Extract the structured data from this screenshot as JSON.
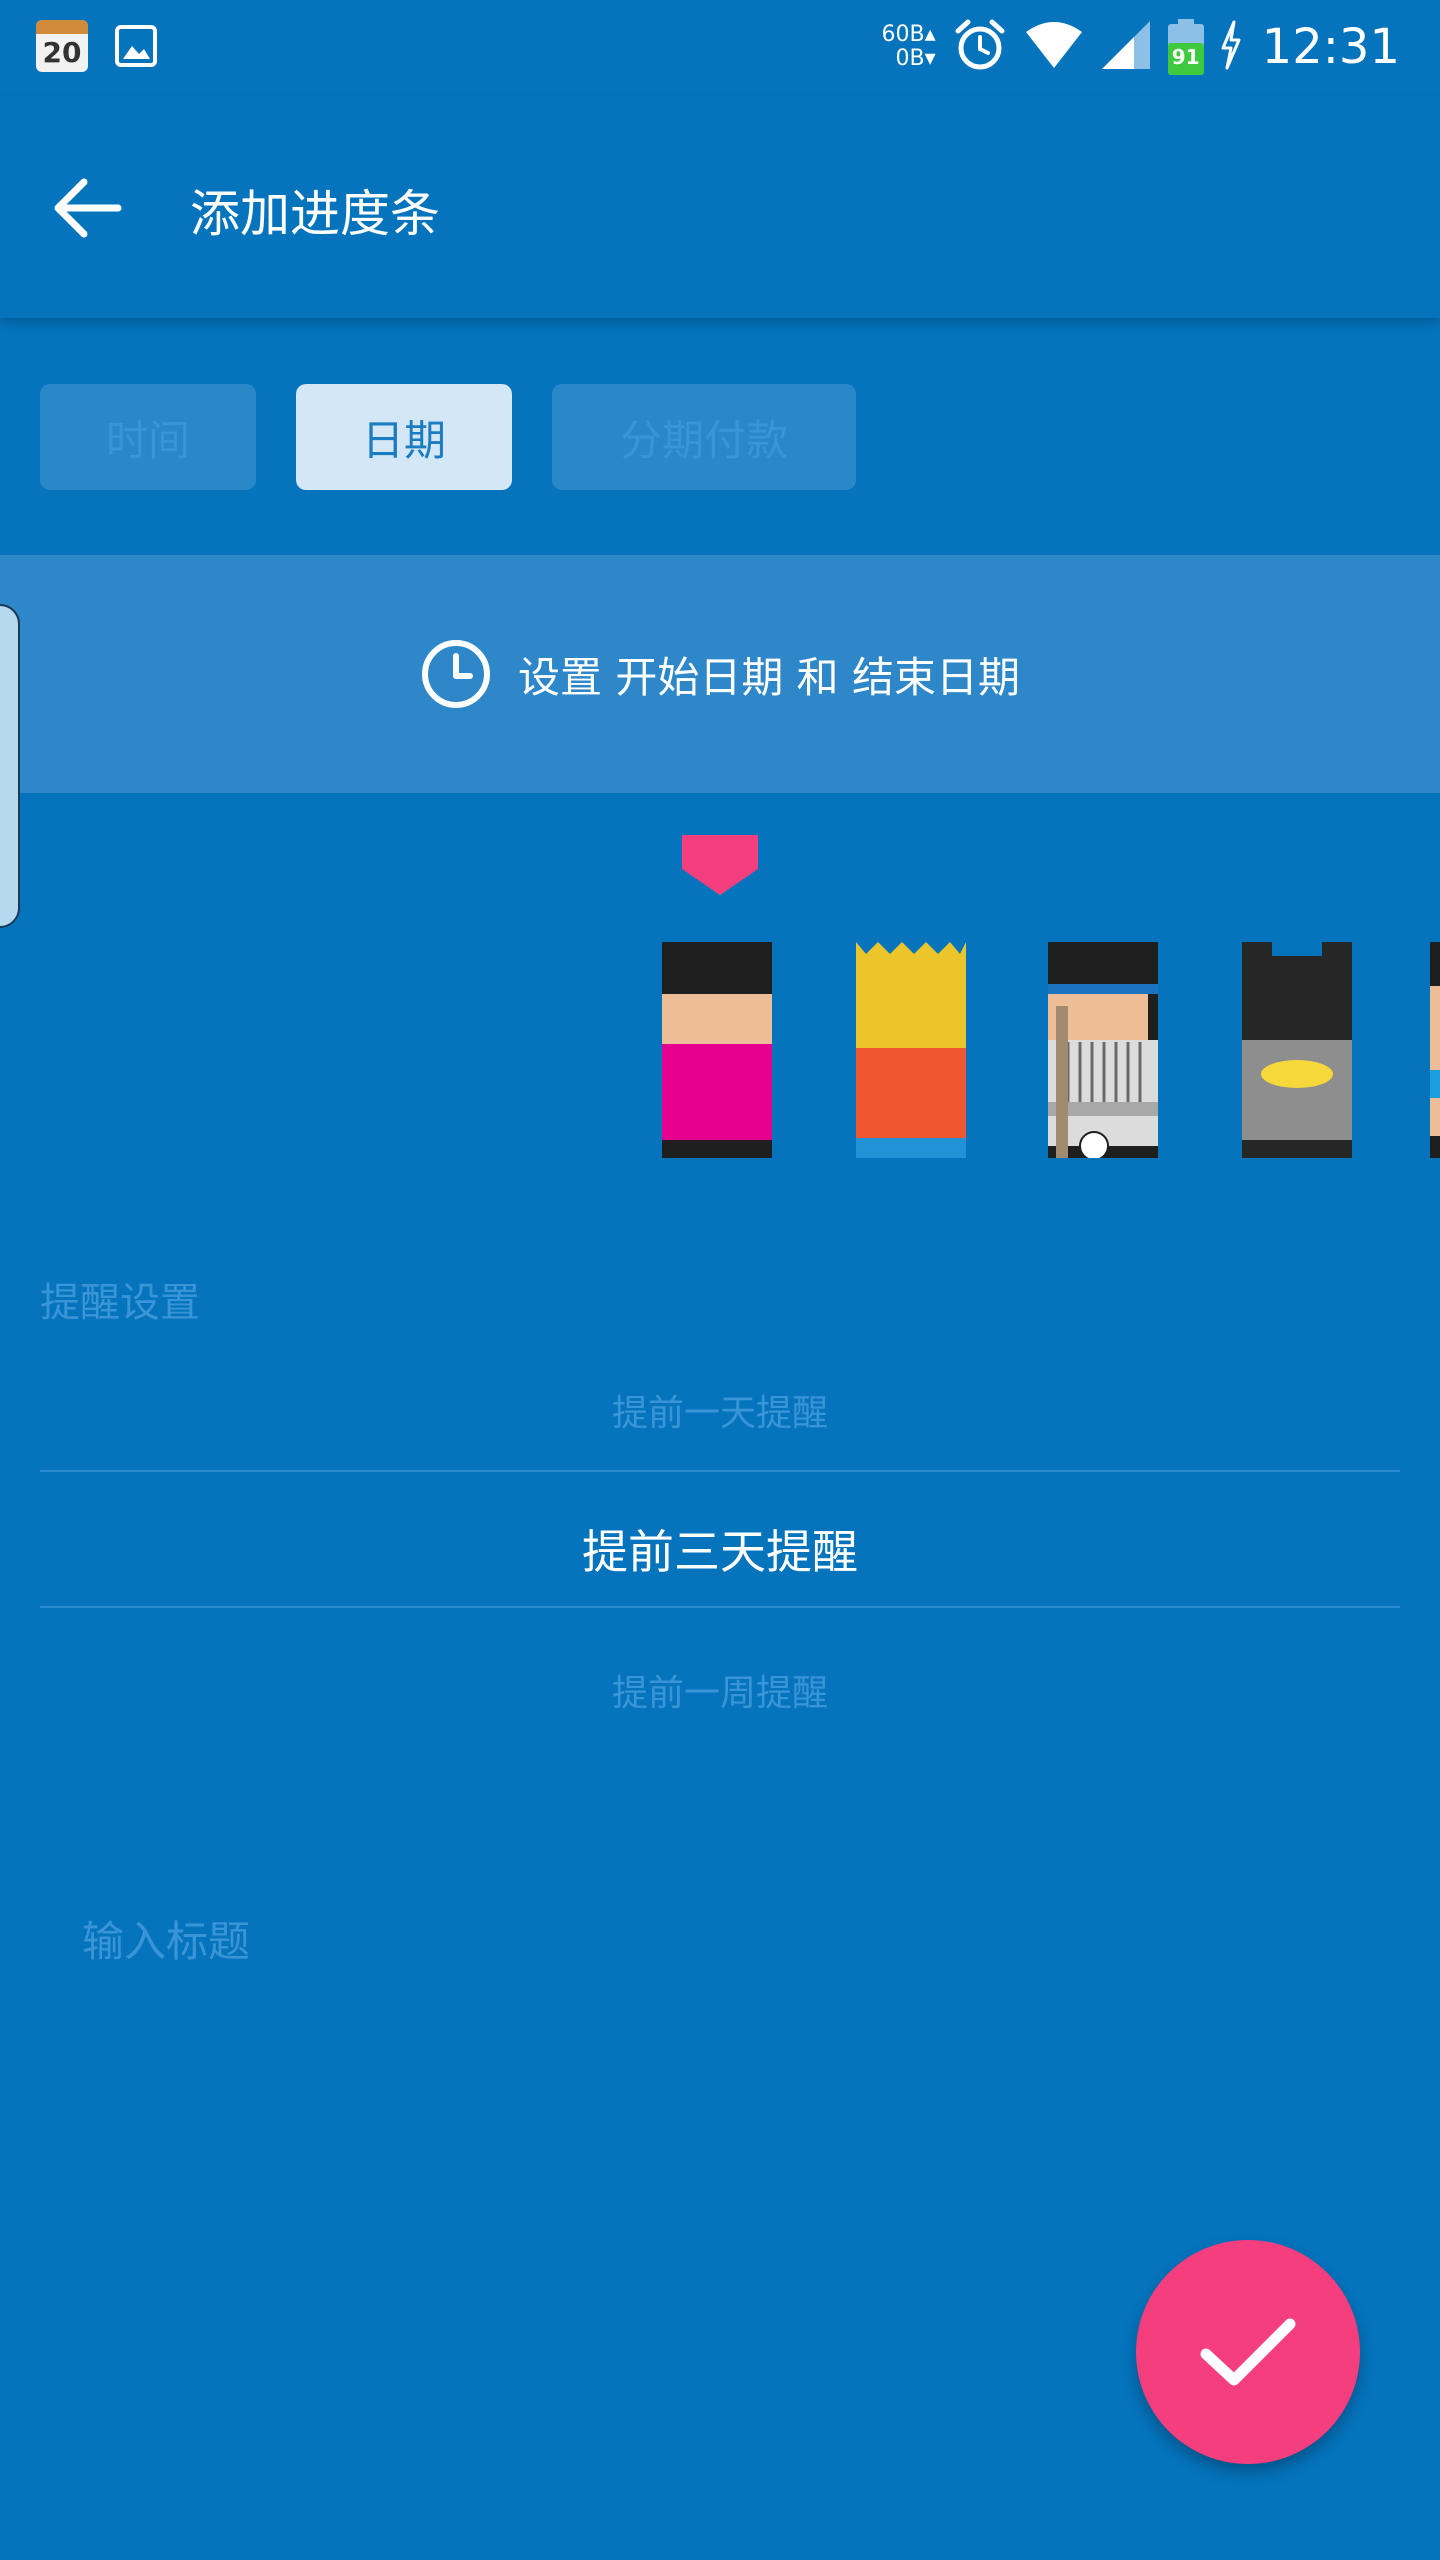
{
  "status_bar": {
    "calendar_day": "20",
    "net_up": "60B▴",
    "net_down": "0B▾",
    "battery_level": "91",
    "time": "12:31"
  },
  "app_bar": {
    "back_icon": "arrow-back-icon",
    "title": "添加进度条"
  },
  "tabs": [
    {
      "label": "时间",
      "active": false
    },
    {
      "label": "日期",
      "active": true
    },
    {
      "label": "分期付款",
      "active": false
    }
  ],
  "date_setting": {
    "icon": "clock-icon",
    "text": "设置 开始日期 和 结束日期"
  },
  "characters": {
    "selected_index": 0,
    "items": [
      "pink-shirt-character",
      "yellow-hair-character",
      "baseball-character",
      "batman-character",
      "partial-character"
    ]
  },
  "reminder": {
    "section_label": "提醒设置",
    "options": [
      "提前一天提醒",
      "提前三天提醒",
      "提前一周提醒"
    ],
    "selected": "提前三天提醒"
  },
  "title_input": {
    "placeholder": "输入标题",
    "value": ""
  },
  "fab": {
    "icon": "check-icon"
  },
  "colors": {
    "background": "#0574bd",
    "accent_pink": "#f53e7e",
    "tab_active_bg": "#d3e7f6",
    "tab_inactive_bg": "#2a88c9"
  }
}
